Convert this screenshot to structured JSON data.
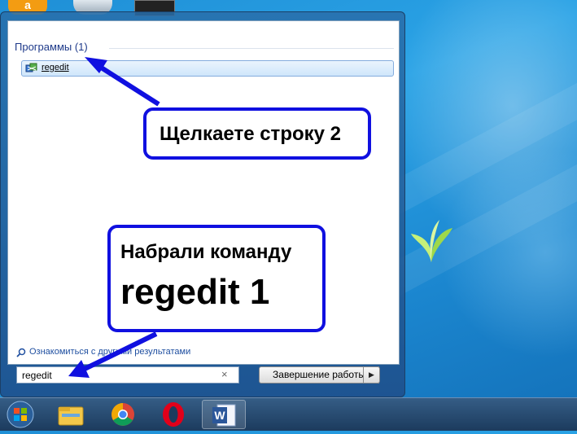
{
  "start_menu": {
    "section_header": "Программы (1)",
    "result_label": "regedit",
    "see_more": "Ознакомиться с другими результатами",
    "search_value": "regedit",
    "clear_glyph": "×",
    "shutdown_label": "Завершение работы",
    "shutdown_arrow": "▶"
  },
  "annotations": {
    "callout_top": "Щелкаете строку 2",
    "callout_bottom_line1": "Набрали команду",
    "callout_bottom_line2": "regedit 1",
    "border_color": "#1010e0"
  },
  "taskbar": {
    "items": [
      "windows-explorer-icon",
      "chrome-icon",
      "opera-icon",
      "word-icon"
    ]
  },
  "colors": {
    "highlight": "#cfe6fb",
    "arrow": "#1010e0"
  }
}
